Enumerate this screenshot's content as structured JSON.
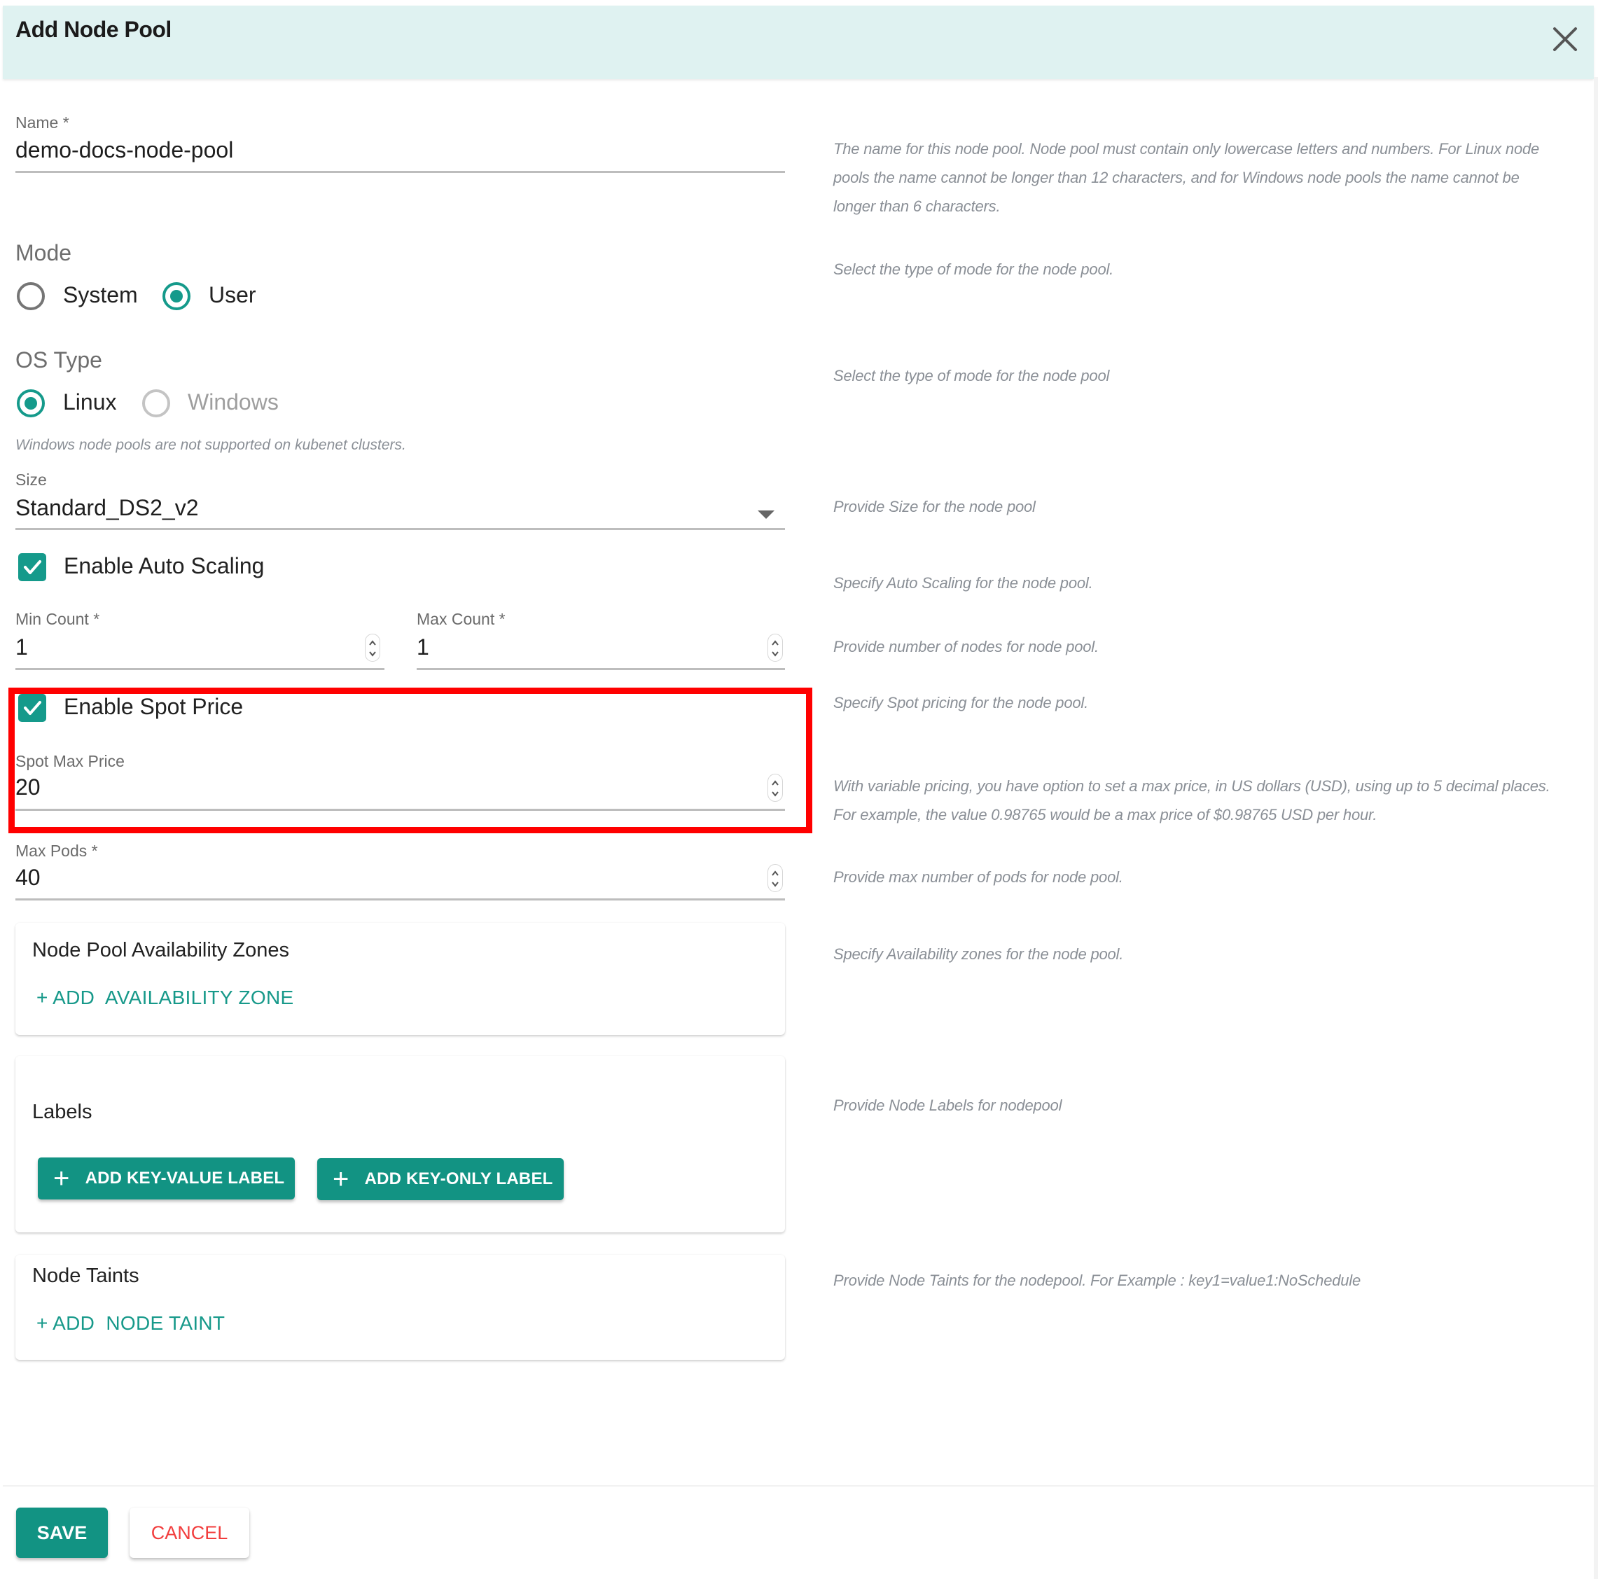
{
  "dialog": {
    "title": "Add Node Pool",
    "close_icon": "close-icon"
  },
  "fields": {
    "name": {
      "label": "Name *",
      "value": "demo-docs-node-pool",
      "description_lines": [
        "The name for this node pool. Node pool must contain only lowercase letters and numbers. For Linux node",
        "pools the name cannot be longer than 12 characters, and for Windows node pools the name cannot be",
        "longer than 6 characters."
      ]
    },
    "mode": {
      "label": "Mode",
      "options": [
        {
          "label": "System",
          "selected": false,
          "disabled": false
        },
        {
          "label": "User",
          "selected": true,
          "disabled": false
        }
      ],
      "description": "Select the type of mode for the node pool."
    },
    "os_type": {
      "label": "OS Type",
      "options": [
        {
          "label": "Linux",
          "selected": true,
          "disabled": false
        },
        {
          "label": "Windows",
          "selected": false,
          "disabled": true
        }
      ],
      "helper": "Windows node pools are not supported on kubenet clusters.",
      "description": "Select the type of mode for the node pool"
    },
    "size": {
      "label": "Size",
      "value": "Standard_DS2_v2",
      "description": "Provide Size for the node pool"
    },
    "auto_scaling": {
      "label": "Enable Auto Scaling",
      "checked": true,
      "description": "Specify Auto Scaling for the node pool."
    },
    "min_count": {
      "label": "Min Count *",
      "value": "1"
    },
    "max_count": {
      "label": "Max Count *",
      "value": "1"
    },
    "count_description": "Provide number of nodes for node pool.",
    "spot_price": {
      "label": "Enable Spot Price",
      "checked": true,
      "description": "Specify Spot pricing for the node pool."
    },
    "spot_max_price": {
      "label": "Spot Max Price",
      "value": "20",
      "description_lines": [
        "With variable pricing, you have option to set a max price, in US dollars (USD), using up to 5 decimal places.",
        "For example, the value 0.98765 would be a max price of $0.98765 USD per hour."
      ]
    },
    "max_pods": {
      "label": "Max Pods *",
      "value": "40",
      "description": "Provide max number of pods for node pool."
    }
  },
  "sections": {
    "availability_zones": {
      "title": "Node Pool Availability Zones",
      "add_label": "+ ADD  AVAILABILITY ZONE",
      "description": "Specify Availability zones for the node pool."
    },
    "labels": {
      "title": "Labels",
      "add_key_value_label": "ADD KEY-VALUE LABEL",
      "add_key_only_label": "ADD KEY-ONLY LABEL",
      "plus_glyph": "+",
      "description": "Provide Node Labels for nodepool"
    },
    "node_taints": {
      "title": "Node Taints",
      "add_label": "+ ADD  NODE TAINT",
      "description": "Provide Node Taints for the nodepool. For Example : key1=value1:NoSchedule"
    }
  },
  "footer": {
    "save_label": "SAVE",
    "cancel_label": "CANCEL"
  },
  "colors": {
    "accent": "#129383",
    "header_bg": "#dff2f1",
    "cancel_text": "#f23d3d",
    "highlight_box": "#ff0000"
  }
}
